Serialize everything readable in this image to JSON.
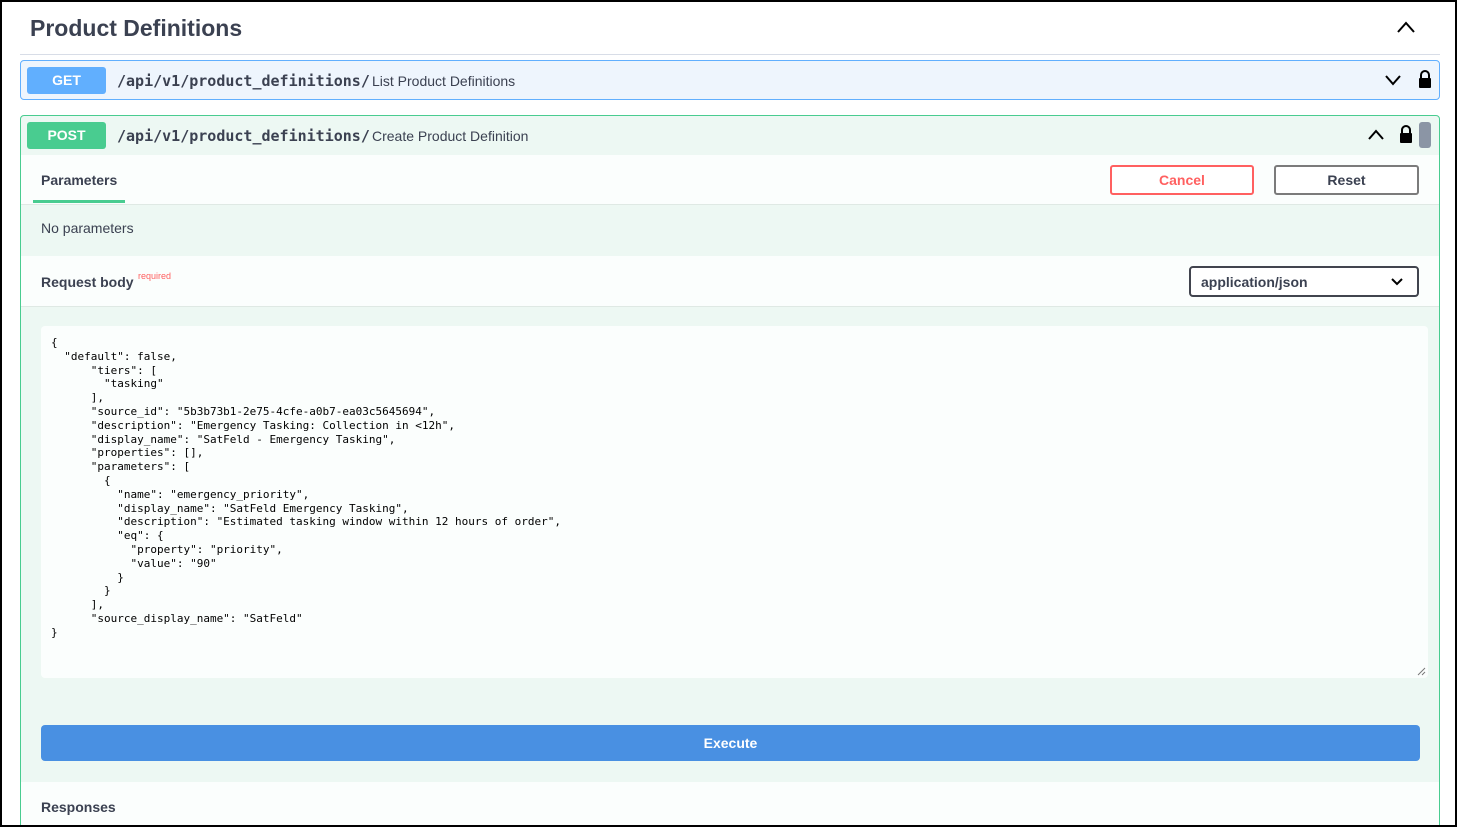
{
  "section": {
    "title": "Product Definitions"
  },
  "get_op": {
    "method": "GET",
    "path": "/api/v1/product_definitions/",
    "summary": "List Product Definitions"
  },
  "post_op": {
    "method": "POST",
    "path": "/api/v1/product_definitions/",
    "summary": "Create Product Definition",
    "tab_parameters": "Parameters",
    "cancel_label": "Cancel",
    "reset_label": "Reset",
    "no_parameters": "No parameters",
    "request_body_label": "Request body",
    "required_label": "required",
    "content_type": "application/json",
    "body": "{\n  \"default\": false,\n      \"tiers\": [\n        \"tasking\"\n      ],\n      \"source_id\": \"5b3b73b1-2e75-4cfe-a0b7-ea03c5645694\",\n      \"description\": \"Emergency Tasking: Collection in <12h\",\n      \"display_name\": \"SatFeld - Emergency Tasking\",\n      \"properties\": [],\n      \"parameters\": [\n        {\n          \"name\": \"emergency_priority\",\n          \"display_name\": \"SatFeld Emergency Tasking\",\n          \"description\": \"Estimated tasking window within 12 hours of order\",\n          \"eq\": {\n            \"property\": \"priority\",\n            \"value\": \"90\"\n          }\n        }\n      ],\n      \"source_display_name\": \"SatFeld\"\n}",
    "execute_label": "Execute",
    "responses_label": "Responses"
  },
  "colors": {
    "get": "#61affe",
    "post": "#49cc90",
    "cancel": "#ff6060",
    "execute": "#4990e2"
  }
}
